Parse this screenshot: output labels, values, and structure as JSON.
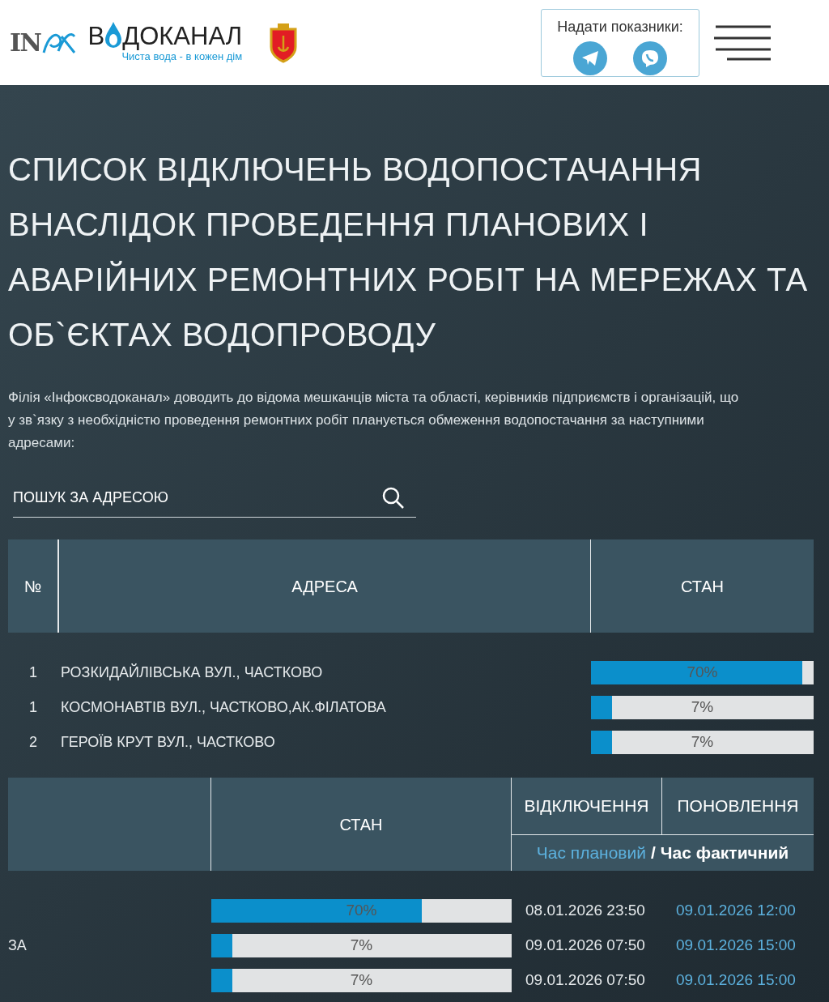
{
  "header": {
    "logo_mark": "IN",
    "logo_start": "В",
    "logo_end": "ДОКАНАЛ",
    "tagline": "Чиста вода - в кожен дім",
    "readings_label": "Надати показники:"
  },
  "title": "СПИСОК ВІДКЛЮЧЕНЬ ВОДОПОСТАЧАННЯ ВНАСЛІДОК ПРОВЕДЕННЯ ПЛАНОВИХ І АВАРІЙНИХ РЕМОНТНИХ РОБІТ НА МЕРЕЖАХ ТА ОБ`ЄКТАХ ВОДОПРОВОДУ",
  "intro": "Філія «Інфоксводоканал» доводить до відома мешканців міста та області, керівників підприємств і організацій, що у зв`язку з необхідністю проведення ремонтних робіт планується обмеження водопостачання за наступними адресами:",
  "search": {
    "placeholder": "ПОШУК ЗА АДРЕСОЮ"
  },
  "table1": {
    "columns": [
      "№",
      "АДРЕСА",
      "СТАН"
    ],
    "rows": [
      {
        "number": "1",
        "address": "РОЗКИДАЙЛІВСЬКА ВУЛ., ЧАСТКОВО",
        "status": "70%",
        "level": 0.95
      },
      {
        "number": "1",
        "address": "КОСМОНАВТІВ ВУЛ., ЧАСТКОВО,АК.ФІЛАТОВА",
        "status": "7%",
        "level": 0.095
      },
      {
        "number": "2",
        "address": "ГЕРОЇВ КРУТ ВУЛ., ЧАСТКОВО",
        "status": "7%",
        "level": 0.095
      }
    ]
  },
  "table2": {
    "status_header": "СТАН",
    "off_header": "ВІДКЛЮЧЕННЯ",
    "on_header": "ПОНОВЛЕННЯ",
    "planned_label": "Час плановий",
    "separator": "/",
    "actual_label": "Час фактичний",
    "rows": [
      {
        "status": "70%",
        "level": 0.7,
        "planned": "08.01.2026 23:50",
        "actual": "09.01.2026 12:00"
      },
      {
        "column_1": "ЗА",
        "status": "7%",
        "level": 0.07,
        "planned": "09.01.2026 07:50",
        "actual": "09.01.2026 15:00"
      },
      {
        "status": "7%",
        "level": 0.07,
        "planned": "09.01.2026 07:50",
        "actual": "09.01.2026 15:00"
      }
    ]
  }
}
